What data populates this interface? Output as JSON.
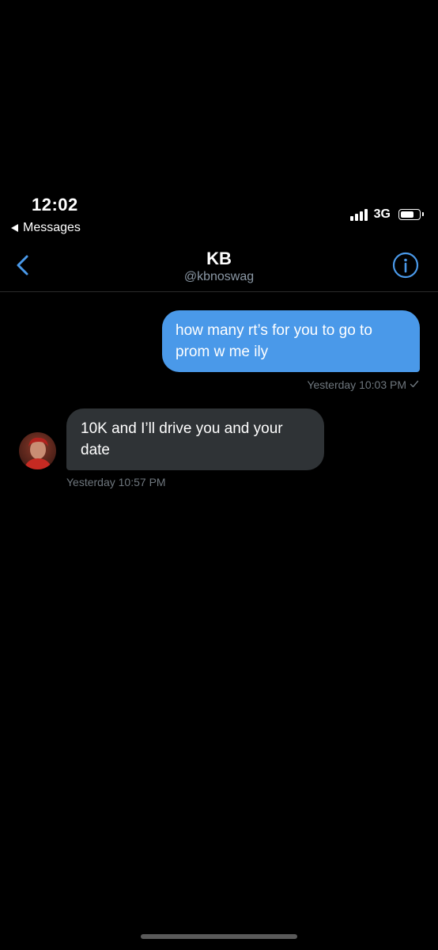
{
  "status_bar": {
    "time": "12:02",
    "back_app_label": "Messages",
    "network": "3G",
    "signal_bars": 4,
    "battery_level": 0.75
  },
  "header": {
    "title": "KB",
    "subtitle": "@kbnoswag",
    "back_icon": "chevron-left-icon",
    "info_icon": "info-icon"
  },
  "colors": {
    "accent": "#4a99e9",
    "incoming_bubble": "#2f3336",
    "meta_text": "#6e767d",
    "background": "#000000"
  },
  "messages": [
    {
      "direction": "outgoing",
      "text": "how many rt’s for you to go to prom w me ily",
      "timestamp": "Yesterday 10:03 PM",
      "status_icon": "checkmark-icon"
    },
    {
      "direction": "incoming",
      "text": "10K and I’ll drive you and your date",
      "timestamp": "Yesterday 10:57 PM",
      "avatar_icon": "avatar"
    }
  ]
}
